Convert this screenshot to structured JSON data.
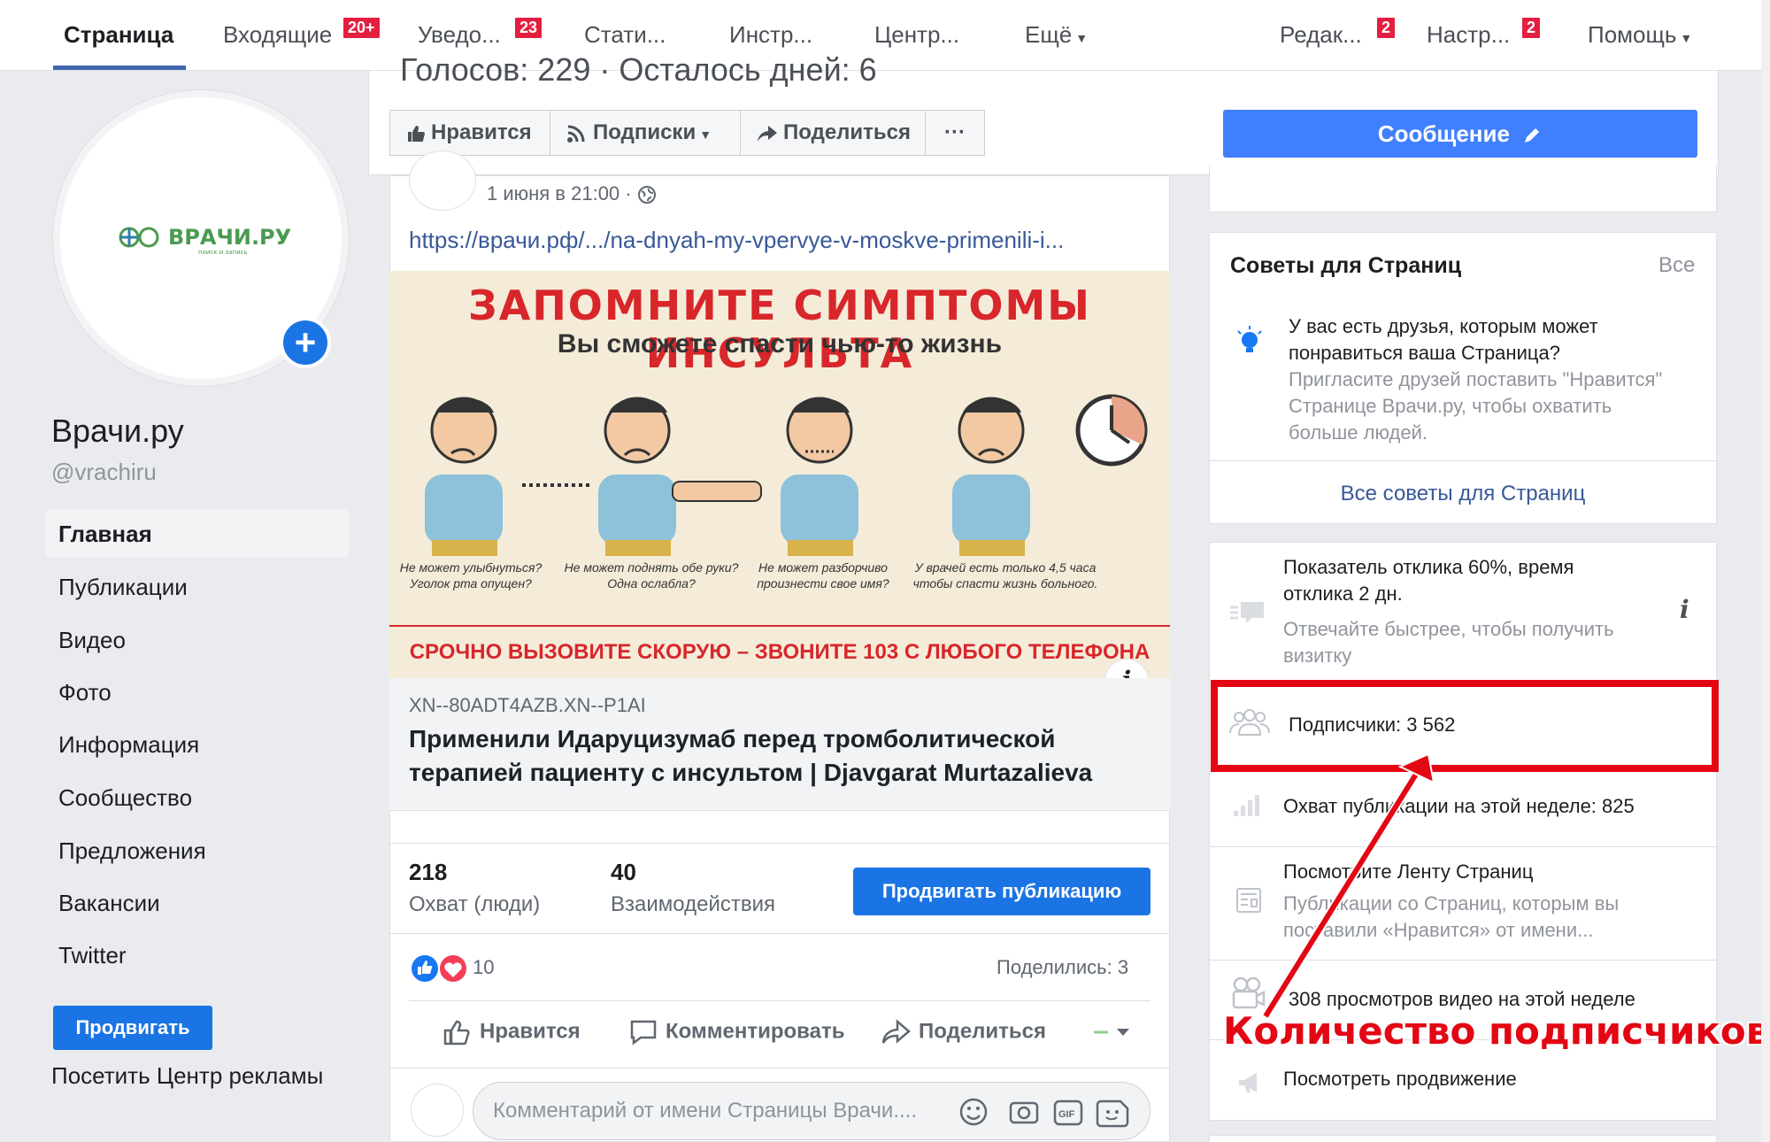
{
  "nav": {
    "items": [
      {
        "label": "Страница"
      },
      {
        "label": "Входящие",
        "badge": "20+"
      },
      {
        "label": "Уведо...",
        "badge": "23"
      },
      {
        "label": "Стати..."
      },
      {
        "label": "Инстр..."
      },
      {
        "label": "Центр..."
      },
      {
        "label": "Ещё"
      },
      {
        "label": "Редак...",
        "badge": "2"
      },
      {
        "label": "Настр...",
        "badge": "2"
      },
      {
        "label": "Помощь"
      }
    ]
  },
  "page": {
    "logo_text": "ВРАЧИ.РУ",
    "logo_sub": "поиск и запись",
    "name": "Врачи.ру",
    "handle": "@vrachiru"
  },
  "sidebar": {
    "items": [
      "Главная",
      "Публикации",
      "Видео",
      "Фото",
      "Информация",
      "Сообщество",
      "Предложения",
      "Вакансии",
      "Twitter"
    ],
    "promote_label": "Продвигать",
    "ads_center_label": "Посетить Центр рекламы"
  },
  "header": {
    "votes_text": "Голосов: 229 · Осталось дней: 6",
    "like_label": "Нравится",
    "follow_label": "Подписки",
    "share_label": "Поделиться",
    "more_label": "···",
    "message_label": "Сообщение"
  },
  "post": {
    "date": "1 июня в 21:00 ·",
    "url": "https://врачи.рф/.../na-dnyah-my-vpervye-v-moskve-primenili-i...",
    "image": {
      "title": "ЗАПОМНИТЕ СИМПТОМЫ ИНСУЛЬТА",
      "subtitle": "Вы сможете спасти чью-то жизнь",
      "captions": [
        "Не может улыбнуться? Уголок рта опущен?",
        "Не может поднять обе руки? Одна ослабла?",
        "Не может разборчиво произнести свое имя?",
        "У врачей есть только 4,5 часа чтобы спасти жизнь больного."
      ],
      "bottom": "СРОЧНО ВЫЗОВИТЕ СКОРУЮ – ЗВОНИТЕ 103 С ЛЮБОГО ТЕЛЕФОНА"
    },
    "link_domain": "XN--80ADT4AZB.XN--P1AI",
    "link_title": "Применили Идаруцизумаб перед тромболитической терапией пациенту с инсультом | Djavgarat Murtazalieva",
    "reach_value": "218",
    "reach_label": "Охват (люди)",
    "engagement_value": "40",
    "engagement_label": "Взаимодействия",
    "boost_label": "Продвигать публикацию",
    "reactions_count": "10",
    "shares_text": "Поделились: 3",
    "action_like": "Нравится",
    "action_comment": "Комментировать",
    "action_share": "Поделиться",
    "comment_placeholder": "Комментарий от имени Страницы Врачи...."
  },
  "right": {
    "tips_title": "Советы для Страниц",
    "tips_all": "Все",
    "tip_main": "У вас есть друзья, которым может понравиться ваша Страница?",
    "tip_sub": "Пригласите друзей поставить \"Нравится\" Странице Врачи.ру, чтобы охватить больше людей.",
    "tips_link": "Все советы для Страниц",
    "response_main": "Показатель отклика 60%, время отклика 2 дн.",
    "response_sub": "Отвечайте быстрее, чтобы получить визитку",
    "followers": "Подписчики: 3 562",
    "reach_week": "Охват публикации на этой неделе: 825",
    "feed_title": "Посмотрите Ленту Страниц",
    "feed_sub": "Публикации со Страниц, которым вы поставили «Нравится» от имени...",
    "video_views": "308 просмотров видео на этой неделе",
    "view_promo": "Посмотреть продвижение"
  },
  "annotation": "Количество подписчиков",
  "colors": {
    "brand_blue": "#1b74e4",
    "link_blue": "#385898",
    "highlight_red": "#e30613",
    "badge_red": "#e41e3f"
  }
}
